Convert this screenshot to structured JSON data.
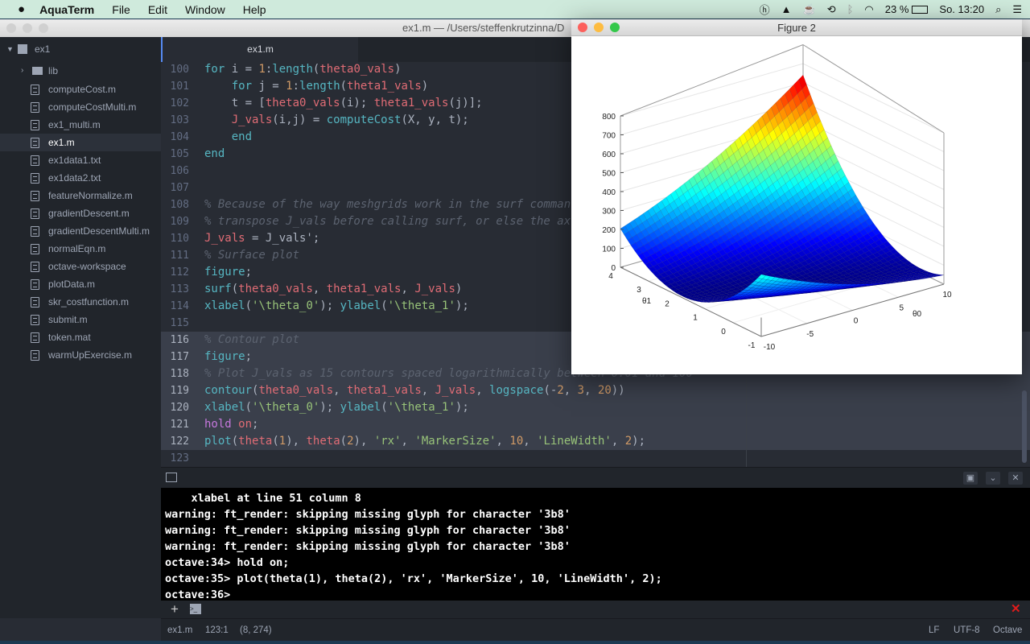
{
  "menubar": {
    "app": "AquaTerm",
    "items": [
      "File",
      "Edit",
      "Window",
      "Help"
    ],
    "battery": "23 %",
    "clock": "So. 13:20"
  },
  "window": {
    "title": "ex1.m — /Users/steffenkrutzinna/D"
  },
  "sidebar": {
    "root": "ex1",
    "folder": "lib",
    "files": [
      "computeCost.m",
      "computeCostMulti.m",
      "ex1_multi.m",
      "ex1.m",
      "ex1data1.txt",
      "ex1data2.txt",
      "featureNormalize.m",
      "gradientDescent.m",
      "gradientDescentMulti.m",
      "normalEqn.m",
      "octave-workspace",
      "plotData.m",
      "skr_costfunction.m",
      "submit.m",
      "token.mat",
      "warmUpExercise.m"
    ],
    "selected": "ex1.m"
  },
  "tab": {
    "label": "ex1.m"
  },
  "editor": {
    "lines": [
      {
        "n": "100",
        "t": [
          [
            "f",
            "for"
          ],
          [
            "p",
            " i = "
          ],
          [
            "n",
            "1"
          ],
          [
            "p",
            ":"
          ],
          [
            "f",
            "length"
          ],
          [
            "p",
            "("
          ],
          [
            "v",
            "theta0_vals"
          ],
          [
            "p",
            ")"
          ]
        ]
      },
      {
        "n": "101",
        "t": [
          [
            "p",
            "    "
          ],
          [
            "f",
            "for"
          ],
          [
            "p",
            " j = "
          ],
          [
            "n",
            "1"
          ],
          [
            "p",
            ":"
          ],
          [
            "f",
            "length"
          ],
          [
            "p",
            "("
          ],
          [
            "v",
            "theta1_vals"
          ],
          [
            "p",
            ")"
          ]
        ]
      },
      {
        "n": "102",
        "t": [
          [
            "p",
            "    t = ["
          ],
          [
            "v",
            "theta0_vals"
          ],
          [
            "p",
            "(i); "
          ],
          [
            "v",
            "theta1_vals"
          ],
          [
            "p",
            "(j)];"
          ]
        ]
      },
      {
        "n": "103",
        "t": [
          [
            "p",
            "    "
          ],
          [
            "v",
            "J_vals"
          ],
          [
            "p",
            "(i,j) = "
          ],
          [
            "f",
            "computeCost"
          ],
          [
            "p",
            "(X, y, t);"
          ]
        ]
      },
      {
        "n": "104",
        "t": [
          [
            "p",
            "    "
          ],
          [
            "f",
            "end"
          ]
        ]
      },
      {
        "n": "105",
        "t": [
          [
            "f",
            "end"
          ]
        ]
      },
      {
        "n": "106",
        "t": []
      },
      {
        "n": "107",
        "t": []
      },
      {
        "n": "108",
        "t": [
          [
            "c",
            "% Because of the way meshgrids work in the surf comman"
          ]
        ]
      },
      {
        "n": "109",
        "t": [
          [
            "c",
            "% transpose J_vals before calling surf, or else the ax"
          ]
        ]
      },
      {
        "n": "110",
        "t": [
          [
            "v",
            "J_vals"
          ],
          [
            "p",
            " = J_vals';"
          ]
        ]
      },
      {
        "n": "111",
        "t": [
          [
            "c",
            "% Surface plot"
          ]
        ]
      },
      {
        "n": "112",
        "t": [
          [
            "f",
            "figure"
          ],
          [
            "p",
            ";"
          ]
        ]
      },
      {
        "n": "113",
        "t": [
          [
            "f",
            "surf"
          ],
          [
            "p",
            "("
          ],
          [
            "v",
            "theta0_vals"
          ],
          [
            "p",
            ", "
          ],
          [
            "v",
            "theta1_vals"
          ],
          [
            "p",
            ", "
          ],
          [
            "v",
            "J_vals"
          ],
          [
            "p",
            ")"
          ]
        ]
      },
      {
        "n": "114",
        "t": [
          [
            "f",
            "xlabel"
          ],
          [
            "p",
            "("
          ],
          [
            "s",
            "'\\theta_0'"
          ],
          [
            "p",
            "); "
          ],
          [
            "f",
            "ylabel"
          ],
          [
            "p",
            "("
          ],
          [
            "s",
            "'\\theta_1'"
          ],
          [
            "p",
            ");"
          ]
        ]
      },
      {
        "n": "115",
        "t": []
      },
      {
        "n": "116",
        "t": [
          [
            "c",
            "% Contour plot"
          ]
        ],
        "hl": true
      },
      {
        "n": "117",
        "t": [
          [
            "f",
            "figure"
          ],
          [
            "p",
            ";"
          ]
        ],
        "hl": true
      },
      {
        "n": "118",
        "t": [
          [
            "c",
            "% Plot J_vals as 15 contours spaced logarithmically between 0.01 and 100"
          ]
        ],
        "hl": true
      },
      {
        "n": "119",
        "t": [
          [
            "f",
            "contour"
          ],
          [
            "p",
            "("
          ],
          [
            "v",
            "theta0_vals"
          ],
          [
            "p",
            ", "
          ],
          [
            "v",
            "theta1_vals"
          ],
          [
            "p",
            ", "
          ],
          [
            "v",
            "J_vals"
          ],
          [
            "p",
            ", "
          ],
          [
            "f",
            "logspace"
          ],
          [
            "p",
            "(-"
          ],
          [
            "n",
            "2"
          ],
          [
            "p",
            ", "
          ],
          [
            "n",
            "3"
          ],
          [
            "p",
            ", "
          ],
          [
            "n",
            "20"
          ],
          [
            "p",
            "))"
          ]
        ],
        "hl": true
      },
      {
        "n": "120",
        "t": [
          [
            "f",
            "xlabel"
          ],
          [
            "p",
            "("
          ],
          [
            "s",
            "'\\theta_0'"
          ],
          [
            "p",
            "); "
          ],
          [
            "f",
            "ylabel"
          ],
          [
            "p",
            "("
          ],
          [
            "s",
            "'\\theta_1'"
          ],
          [
            "p",
            ");"
          ]
        ],
        "hl": true
      },
      {
        "n": "121",
        "t": [
          [
            "k",
            "hold"
          ],
          [
            "p",
            " "
          ],
          [
            "v",
            "on"
          ],
          [
            "p",
            ";"
          ]
        ],
        "hl": true
      },
      {
        "n": "122",
        "t": [
          [
            "f",
            "plot"
          ],
          [
            "p",
            "("
          ],
          [
            "v",
            "theta"
          ],
          [
            "p",
            "("
          ],
          [
            "n",
            "1"
          ],
          [
            "p",
            "), "
          ],
          [
            "v",
            "theta"
          ],
          [
            "p",
            "("
          ],
          [
            "n",
            "2"
          ],
          [
            "p",
            "), "
          ],
          [
            "s",
            "'rx'"
          ],
          [
            "p",
            ", "
          ],
          [
            "s",
            "'MarkerSize'"
          ],
          [
            "p",
            ", "
          ],
          [
            "n",
            "10"
          ],
          [
            "p",
            ", "
          ],
          [
            "s",
            "'LineWidth'"
          ],
          [
            "p",
            ", "
          ],
          [
            "n",
            "2"
          ],
          [
            "p",
            ");"
          ]
        ],
        "hl": true
      },
      {
        "n": "123",
        "t": []
      }
    ]
  },
  "terminal": {
    "lines": [
      "    xlabel at line 51 column 8",
      "warning: ft_render: skipping missing glyph for character '3b8'",
      "warning: ft_render: skipping missing glyph for character '3b8'",
      "warning: ft_render: skipping missing glyph for character '3b8'",
      "octave:34> hold on;",
      "octave:35> plot(theta(1), theta(2), 'rx', 'MarkerSize', 10, 'LineWidth', 2);",
      "octave:36>"
    ]
  },
  "status": {
    "file": "ex1.m",
    "cursor": "123:1",
    "selection": "(8, 274)",
    "line_ending": "LF",
    "encoding": "UTF-8",
    "grammar": "Octave"
  },
  "figure": {
    "title": "Figure 2",
    "xlabel": "θ0",
    "ylabel": "θ1",
    "chart_data": {
      "type": "surface",
      "xlabel": "θ0",
      "ylabel": "θ1",
      "xlim": [
        -10,
        10
      ],
      "ylim": [
        -1,
        4
      ],
      "zlim": [
        0,
        800
      ],
      "xticks": [
        "-10",
        "-5",
        "0",
        "5",
        "10"
      ],
      "yticks": [
        "-1",
        "0",
        "1",
        "2",
        "3",
        "4"
      ],
      "zticks": [
        "0",
        "100",
        "200",
        "300",
        "400",
        "500",
        "600",
        "700",
        "800"
      ],
      "corner_values": {
        "x-10_y4": 200,
        "x10_y4": 760,
        "x10_y-1": 40
      },
      "colormap": "jet"
    }
  }
}
